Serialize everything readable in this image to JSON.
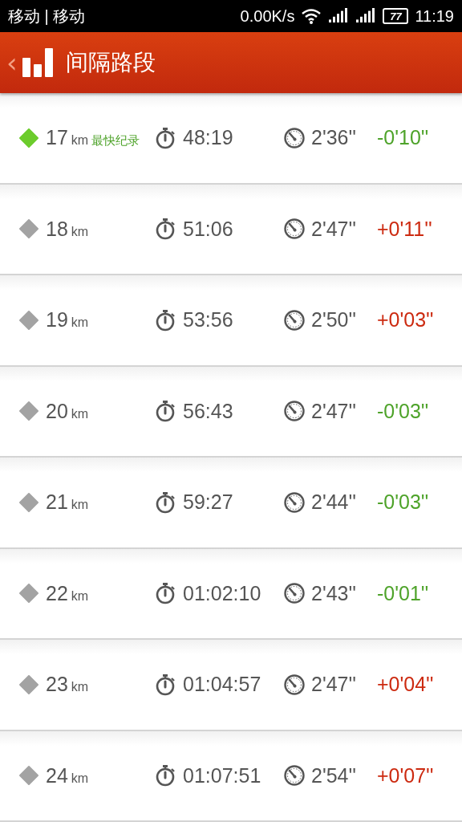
{
  "status_bar": {
    "carrier": "移动 | 移动",
    "speed": "0.00K/s",
    "battery": "77",
    "time": "11:19"
  },
  "header": {
    "back": "‹",
    "title": "间隔路段"
  },
  "rows": [
    {
      "distance": "17",
      "unit": "km",
      "best": true,
      "best_label": "最快纪录",
      "time": "48:19",
      "pace": "2'36''",
      "diff": "-0'10''",
      "color": "#4ea32a"
    },
    {
      "distance": "18",
      "unit": "km",
      "best": false,
      "time": "51:06",
      "pace": "2'47''",
      "diff": "+0'11''",
      "color": "#cc2a10"
    },
    {
      "distance": "19",
      "unit": "km",
      "best": false,
      "time": "53:56",
      "pace": "2'50''",
      "diff": "+0'03''",
      "color": "#cc2a10"
    },
    {
      "distance": "20",
      "unit": "km",
      "best": false,
      "time": "56:43",
      "pace": "2'47''",
      "diff": "-0'03''",
      "color": "#4ea32a"
    },
    {
      "distance": "21",
      "unit": "km",
      "best": false,
      "time": "59:27",
      "pace": "2'44''",
      "diff": "-0'03''",
      "color": "#4ea32a"
    },
    {
      "distance": "22",
      "unit": "km",
      "best": false,
      "time": "01:02:10",
      "pace": "2'43''",
      "diff": "-0'01''",
      "color": "#4ea32a"
    },
    {
      "distance": "23",
      "unit": "km",
      "best": false,
      "time": "01:04:57",
      "pace": "2'47''",
      "diff": "+0'04''",
      "color": "#cc2a10"
    },
    {
      "distance": "24",
      "unit": "km",
      "best": false,
      "time": "01:07:51",
      "pace": "2'54''",
      "diff": "+0'07''",
      "color": "#cc2a10"
    }
  ]
}
